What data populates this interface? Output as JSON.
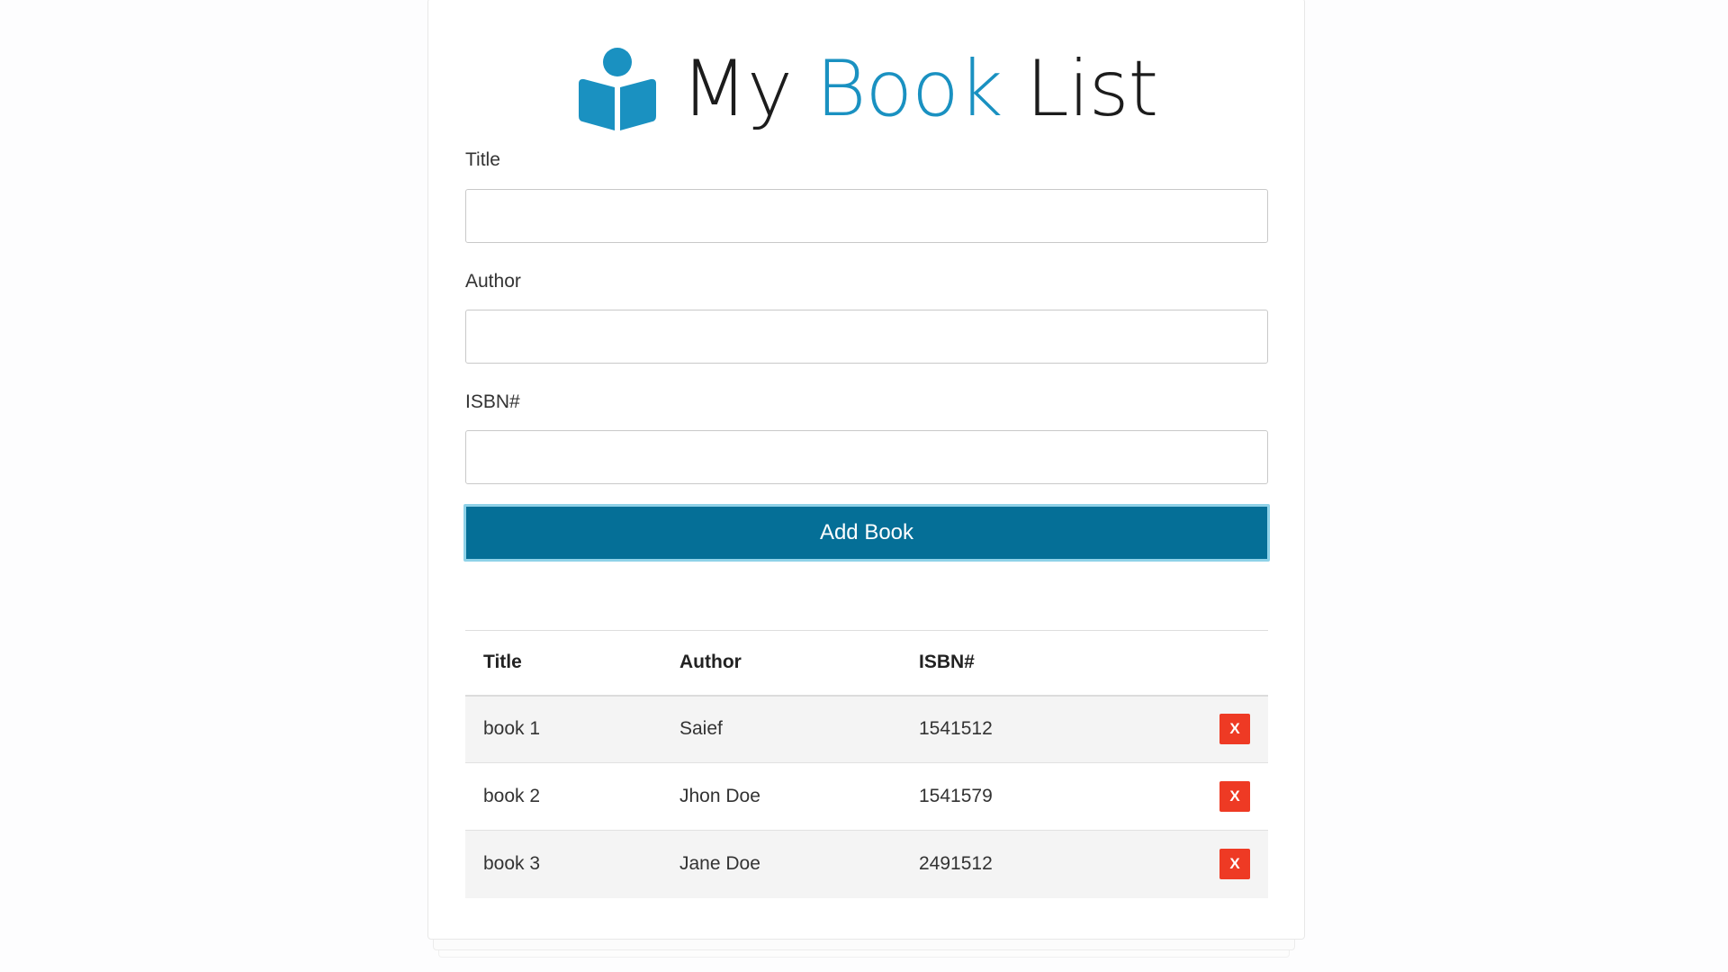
{
  "colors": {
    "accent": "#1a91c1",
    "button": "#056f97",
    "delete": "#ee3a24"
  },
  "header": {
    "logo_icon": "reading-person-book-icon",
    "title_part1": "My ",
    "title_accent": "Book",
    "title_part2": " List"
  },
  "form": {
    "title_label": "Title",
    "title_value": "",
    "author_label": "Author",
    "author_value": "",
    "isbn_label": "ISBN#",
    "isbn_value": "",
    "submit_label": "Add Book"
  },
  "table": {
    "headers": {
      "title": "Title",
      "author": "Author",
      "isbn": "ISBN#"
    },
    "rows": [
      {
        "title": "book 1",
        "author": "Saief",
        "isbn": "1541512",
        "delete_label": "X"
      },
      {
        "title": "book 2",
        "author": "Jhon Doe",
        "isbn": "1541579",
        "delete_label": "X"
      },
      {
        "title": "book 3",
        "author": "Jane Doe",
        "isbn": "2491512",
        "delete_label": "X"
      }
    ]
  }
}
